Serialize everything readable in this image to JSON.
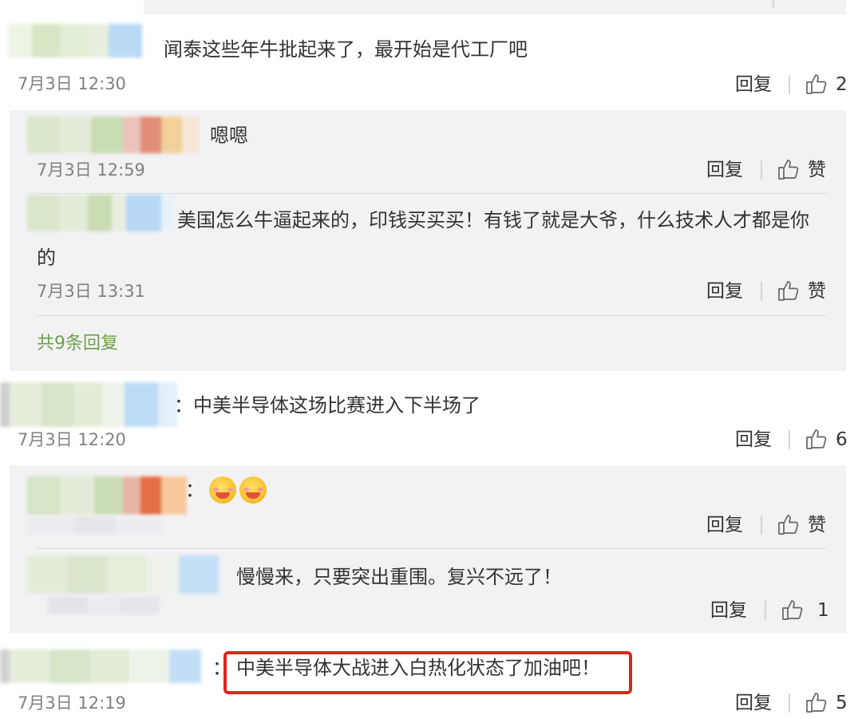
{
  "ui": {
    "reply_label": "回复",
    "like_label": "赞"
  },
  "comments": [
    {
      "text": "闻泰这些年牛批起来了，最开始是代工厂吧",
      "time": "7月3日 12:30",
      "likes": "2",
      "replies": [
        {
          "text": "嗯嗯",
          "time": "7月3日 12:59"
        },
        {
          "text_line1": "美国怎么牛逼起来的，印钱买买买！有钱了就是大爷，什么技术人才都是你",
          "text_line2": "的",
          "time": "7月3日 13:31"
        }
      ],
      "more_replies": "共9条回复"
    },
    {
      "text": "：中美半导体这场比赛进入下半场了",
      "time": "7月3日 12:20",
      "likes": "6",
      "replies": [
        {
          "text": "："
        },
        {
          "text": "慢慢来，只要突出重围。复兴不远了！",
          "likes": "1"
        }
      ]
    },
    {
      "text_prefix": "：",
      "text": "中美半导体大战进入白热化状态了加油吧！",
      "time": "7月3日 12:19",
      "likes": "5"
    }
  ],
  "colors": {
    "panel_bg": "#f2f2f5",
    "more_link": "#6ca14a",
    "highlight_box": "#e3231f",
    "date_text": "#808080"
  },
  "icons": [
    "thumbs-up-icon",
    "emoji-icon"
  ]
}
